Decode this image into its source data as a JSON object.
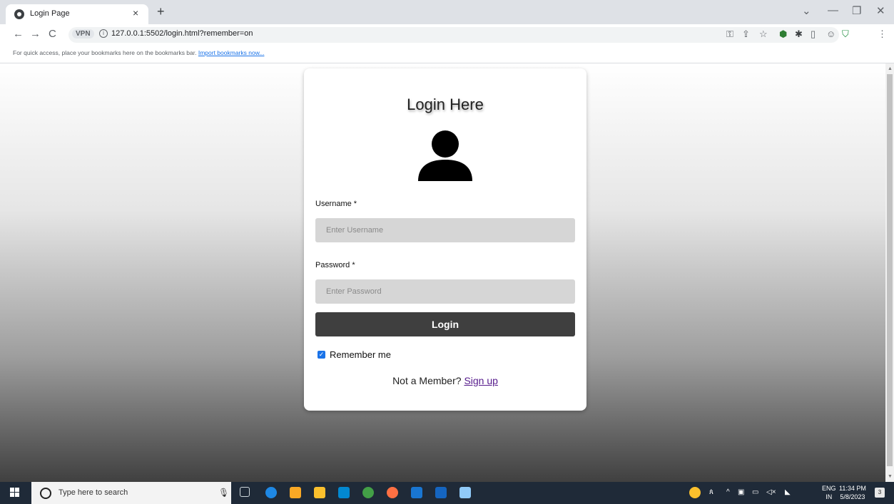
{
  "browser": {
    "tab_title": "Login Page",
    "tab_close": "×",
    "new_tab": "+",
    "url": "127.0.0.1:5502/login.html?remember=on",
    "vpn_badge": "VPN",
    "back": "←",
    "forward": "→",
    "reload": "C",
    "win_minimize": "—",
    "win_restore": "❐",
    "win_close": "✕",
    "win_dropdown": "⌄"
  },
  "bookmarks": {
    "text": "For quick access, place your bookmarks here on the bookmarks bar.",
    "link": "Import bookmarks now..."
  },
  "login": {
    "title": "Login Here",
    "username_label": "Username *",
    "username_placeholder": "Enter Username",
    "password_label": "Password *",
    "password_placeholder": "Enter Password",
    "button": "Login",
    "remember_label": "Remember me",
    "remember_checked": true,
    "member_text": "Not a Member?",
    "signup_link": "Sign up"
  },
  "taskbar": {
    "search_placeholder": "Type here to search",
    "lang_top": "ENG",
    "lang_bottom": "IN",
    "time": "11:34 PM",
    "date": "5/8/2023",
    "notifications": "3"
  },
  "colors": {
    "login_button": "#3f3f3f",
    "input_bg": "#d6d6d6",
    "checkbox": "#1a73e8",
    "link_visited": "#551a8b",
    "taskbar": "#1f2a38"
  }
}
